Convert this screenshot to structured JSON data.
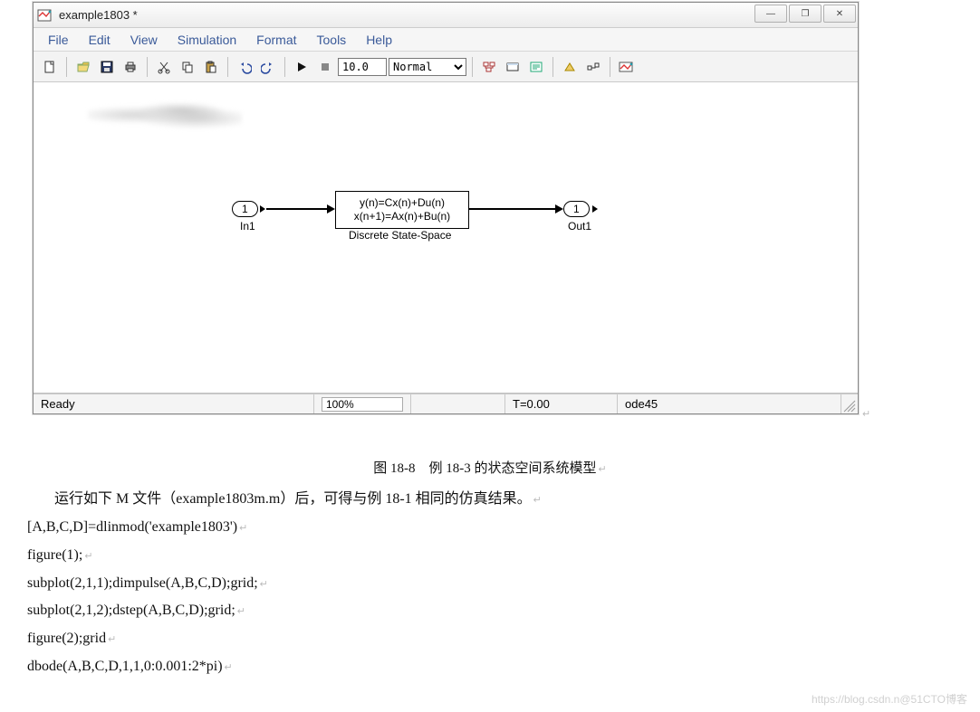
{
  "window": {
    "title": "example1803 *",
    "controls": {
      "min": "—",
      "max": "❐",
      "close": "✕"
    }
  },
  "menu": {
    "file": "File",
    "edit": "Edit",
    "view": "View",
    "simulation": "Simulation",
    "format": "Format",
    "tools": "Tools",
    "help": "Help"
  },
  "toolbar": {
    "stop_time": "10.0",
    "mode": "Normal"
  },
  "model": {
    "in": {
      "num": "1",
      "label": "In1"
    },
    "block": {
      "line1": "y(n)=Cx(n)+Du(n)",
      "line2": "x(n+1)=Ax(n)+Bu(n)",
      "label": "Discrete State-Space"
    },
    "out": {
      "num": "1",
      "label": "Out1"
    }
  },
  "status": {
    "ready": "Ready",
    "zoom": "100%",
    "time": "T=0.00",
    "solver": "ode45"
  },
  "caption": "图 18-8　例 18-3 的状态空间系统模型",
  "paragraph": "运行如下 M 文件（example1803m.m）后，可得与例 18-1 相同的仿真结果。",
  "code": {
    "l1": "[A,B,C,D]=dlinmod('example1803')",
    "l2": "figure(1);",
    "l3": "subplot(2,1,1);dimpulse(A,B,C,D);grid;",
    "l4": "subplot(2,1,2);dstep(A,B,C,D);grid;",
    "l5": "figure(2);grid",
    "l6": "dbode(A,B,C,D,1,1,0:0.001:2*pi)"
  },
  "watermark": "https://blog.csdn.n@51CTO博客",
  "ret": "↵"
}
